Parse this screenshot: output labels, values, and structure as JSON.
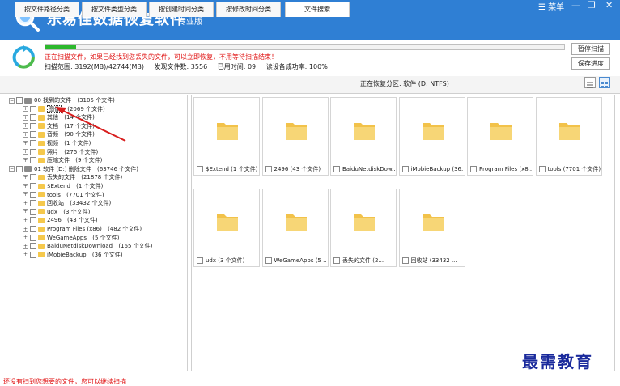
{
  "app": {
    "title": "乐易佳数据恢复软件",
    "edition": "专业版",
    "menu": "菜单"
  },
  "window_controls": {
    "minimize": "—",
    "restore": "❐",
    "close": "✕"
  },
  "scan": {
    "progress_percent": 6,
    "message": "正在扫描文件，如果已经找到您丢失的文件，可以立即恢复，不用等待扫描结束！",
    "range": "扫描范围: 3192(MB)/42744(MB)",
    "files_found": "发现文件数: 3556",
    "elapsed": "已用时间: 09",
    "read_rate": "读设备成功率: 100%"
  },
  "buttons": {
    "pause": "暂停扫描",
    "save": "保存进度"
  },
  "tabs": [
    "按文件路径分类",
    "按文件类型分类",
    "按创建时间分类",
    "按修改时间分类",
    "文件搜索"
  ],
  "location": "正在恢复分区: 软件 (D: NTFS)",
  "colors": {
    "titlebar": "#2f7fd4",
    "progress": "#2db82d",
    "alert": "#e01010",
    "watermark": "#1a2a9c",
    "folder": "#f5c84c"
  },
  "tree": [
    {
      "label": "00 找到的文件",
      "count": "(3105 个文件)",
      "level": 0,
      "icon": "hdd-icon"
    },
    {
      "label": "图像",
      "count": "(2069 个文件)",
      "level": 1,
      "icon": "folder-icon",
      "selected": true
    },
    {
      "label": "其他",
      "count": "(14 个文件)",
      "level": 1,
      "icon": "folder-icon"
    },
    {
      "label": "文档",
      "count": "(17 个文件)",
      "level": 1,
      "icon": "folder-icon"
    },
    {
      "label": "音频",
      "count": "(90 个文件)",
      "level": 1,
      "icon": "folder-icon"
    },
    {
      "label": "视频",
      "count": "(1 个文件)",
      "level": 1,
      "icon": "folder-icon"
    },
    {
      "label": "照片",
      "count": "(275 个文件)",
      "level": 1,
      "icon": "folder-icon"
    },
    {
      "label": "压缩文件",
      "count": "(9 个文件)",
      "level": 1,
      "icon": "folder-icon"
    },
    {
      "label": "01 软件 (D:) 删除文件",
      "count": "(63746 个文件)",
      "level": 0,
      "icon": "hdd-icon"
    },
    {
      "label": "丢失的文件",
      "count": "(21878 个文件)",
      "level": 1,
      "icon": "folder-icon"
    },
    {
      "label": "$Extend",
      "count": "(1 个文件)",
      "level": 1,
      "icon": "folder-icon"
    },
    {
      "label": "tools",
      "count": "(7701 个文件)",
      "level": 1,
      "icon": "folder-icon"
    },
    {
      "label": "回收站",
      "count": "(33432 个文件)",
      "level": 1,
      "icon": "folder-icon"
    },
    {
      "label": "udx",
      "count": "(3 个文件)",
      "level": 1,
      "icon": "folder-icon"
    },
    {
      "label": "2496",
      "count": "(43 个文件)",
      "level": 1,
      "icon": "folder-icon"
    },
    {
      "label": "Program Files (x86)",
      "count": "(482 个文件)",
      "level": 1,
      "icon": "folder-icon"
    },
    {
      "label": "WeGameApps",
      "count": "(5 个文件)",
      "level": 1,
      "icon": "folder-icon"
    },
    {
      "label": "BaiduNetdiskDownload",
      "count": "(165 个文件)",
      "level": 1,
      "icon": "folder-icon"
    },
    {
      "label": "iMobieBackup",
      "count": "(36 个文件)",
      "level": 1,
      "icon": "folder-icon"
    }
  ],
  "tiles": [
    "$Extend (1 个文件)",
    "2496 (43 个文件)",
    "BaiduNetdiskDow...",
    "iMobieBackup (36...",
    "Program Files (x8...",
    "tools (7701 个文件)",
    "udx (3 个文件)",
    "WeGameApps (5 ...",
    "丢失的文件 (2...",
    "回收站 (33432 ..."
  ],
  "footer": {
    "hint": "还没有扫到您想要的文件，您可以继续扫描"
  },
  "watermark": "最需教育"
}
